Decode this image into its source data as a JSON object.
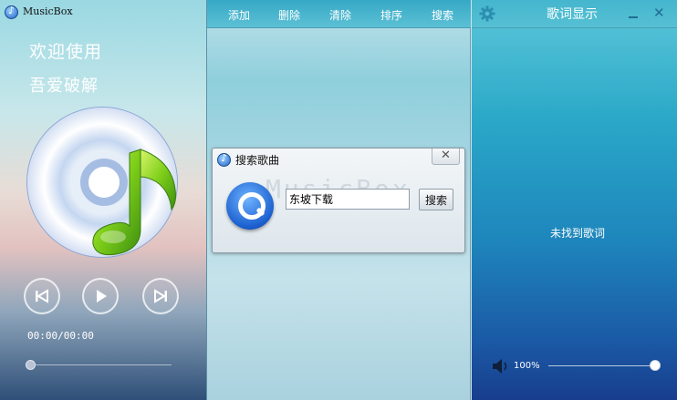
{
  "left": {
    "app_title": "MusicBox",
    "welcome": "欢迎使用",
    "subwelcome": "吾爱破解",
    "time": "00:00/00:00",
    "progress": 0
  },
  "toolbar": {
    "items": [
      "添加",
      "删除",
      "清除",
      "排序",
      "搜索"
    ]
  },
  "dialog": {
    "title": "搜索歌曲",
    "close": "✕",
    "watermark": "MusicBox",
    "input_value": "东坡下载",
    "search_label": "搜索"
  },
  "right": {
    "title": "歌词显示",
    "close": "✕",
    "no_lyric": "未找到歌词",
    "volume_text": "100%",
    "volume": 1.0
  }
}
